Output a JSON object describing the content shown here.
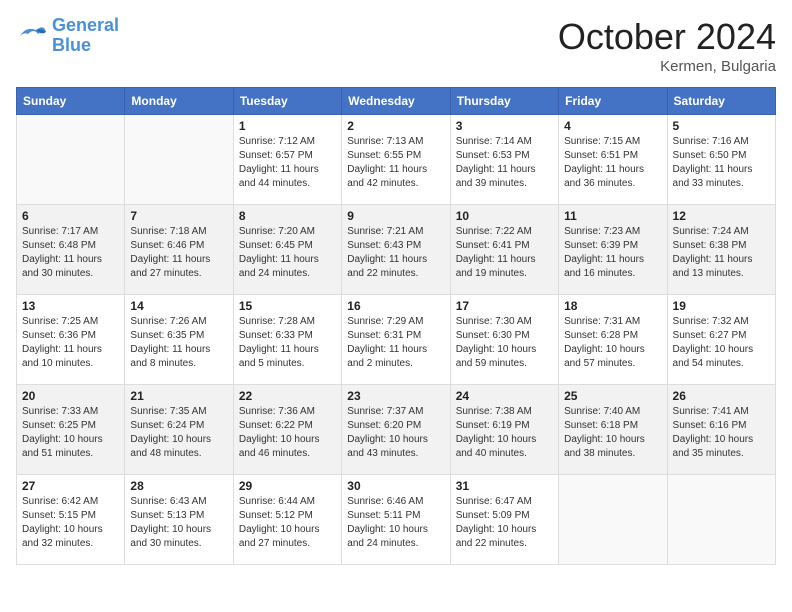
{
  "logo": {
    "line1": "General",
    "line2": "Blue"
  },
  "title": "October 2024",
  "location": "Kermen, Bulgaria",
  "days_of_week": [
    "Sunday",
    "Monday",
    "Tuesday",
    "Wednesday",
    "Thursday",
    "Friday",
    "Saturday"
  ],
  "weeks": [
    [
      {
        "day": "",
        "info": ""
      },
      {
        "day": "",
        "info": ""
      },
      {
        "day": "1",
        "sunrise": "Sunrise: 7:12 AM",
        "sunset": "Sunset: 6:57 PM",
        "daylight": "Daylight: 11 hours and 44 minutes."
      },
      {
        "day": "2",
        "sunrise": "Sunrise: 7:13 AM",
        "sunset": "Sunset: 6:55 PM",
        "daylight": "Daylight: 11 hours and 42 minutes."
      },
      {
        "day": "3",
        "sunrise": "Sunrise: 7:14 AM",
        "sunset": "Sunset: 6:53 PM",
        "daylight": "Daylight: 11 hours and 39 minutes."
      },
      {
        "day": "4",
        "sunrise": "Sunrise: 7:15 AM",
        "sunset": "Sunset: 6:51 PM",
        "daylight": "Daylight: 11 hours and 36 minutes."
      },
      {
        "day": "5",
        "sunrise": "Sunrise: 7:16 AM",
        "sunset": "Sunset: 6:50 PM",
        "daylight": "Daylight: 11 hours and 33 minutes."
      }
    ],
    [
      {
        "day": "6",
        "sunrise": "Sunrise: 7:17 AM",
        "sunset": "Sunset: 6:48 PM",
        "daylight": "Daylight: 11 hours and 30 minutes."
      },
      {
        "day": "7",
        "sunrise": "Sunrise: 7:18 AM",
        "sunset": "Sunset: 6:46 PM",
        "daylight": "Daylight: 11 hours and 27 minutes."
      },
      {
        "day": "8",
        "sunrise": "Sunrise: 7:20 AM",
        "sunset": "Sunset: 6:45 PM",
        "daylight": "Daylight: 11 hours and 24 minutes."
      },
      {
        "day": "9",
        "sunrise": "Sunrise: 7:21 AM",
        "sunset": "Sunset: 6:43 PM",
        "daylight": "Daylight: 11 hours and 22 minutes."
      },
      {
        "day": "10",
        "sunrise": "Sunrise: 7:22 AM",
        "sunset": "Sunset: 6:41 PM",
        "daylight": "Daylight: 11 hours and 19 minutes."
      },
      {
        "day": "11",
        "sunrise": "Sunrise: 7:23 AM",
        "sunset": "Sunset: 6:39 PM",
        "daylight": "Daylight: 11 hours and 16 minutes."
      },
      {
        "day": "12",
        "sunrise": "Sunrise: 7:24 AM",
        "sunset": "Sunset: 6:38 PM",
        "daylight": "Daylight: 11 hours and 13 minutes."
      }
    ],
    [
      {
        "day": "13",
        "sunrise": "Sunrise: 7:25 AM",
        "sunset": "Sunset: 6:36 PM",
        "daylight": "Daylight: 11 hours and 10 minutes."
      },
      {
        "day": "14",
        "sunrise": "Sunrise: 7:26 AM",
        "sunset": "Sunset: 6:35 PM",
        "daylight": "Daylight: 11 hours and 8 minutes."
      },
      {
        "day": "15",
        "sunrise": "Sunrise: 7:28 AM",
        "sunset": "Sunset: 6:33 PM",
        "daylight": "Daylight: 11 hours and 5 minutes."
      },
      {
        "day": "16",
        "sunrise": "Sunrise: 7:29 AM",
        "sunset": "Sunset: 6:31 PM",
        "daylight": "Daylight: 11 hours and 2 minutes."
      },
      {
        "day": "17",
        "sunrise": "Sunrise: 7:30 AM",
        "sunset": "Sunset: 6:30 PM",
        "daylight": "Daylight: 10 hours and 59 minutes."
      },
      {
        "day": "18",
        "sunrise": "Sunrise: 7:31 AM",
        "sunset": "Sunset: 6:28 PM",
        "daylight": "Daylight: 10 hours and 57 minutes."
      },
      {
        "day": "19",
        "sunrise": "Sunrise: 7:32 AM",
        "sunset": "Sunset: 6:27 PM",
        "daylight": "Daylight: 10 hours and 54 minutes."
      }
    ],
    [
      {
        "day": "20",
        "sunrise": "Sunrise: 7:33 AM",
        "sunset": "Sunset: 6:25 PM",
        "daylight": "Daylight: 10 hours and 51 minutes."
      },
      {
        "day": "21",
        "sunrise": "Sunrise: 7:35 AM",
        "sunset": "Sunset: 6:24 PM",
        "daylight": "Daylight: 10 hours and 48 minutes."
      },
      {
        "day": "22",
        "sunrise": "Sunrise: 7:36 AM",
        "sunset": "Sunset: 6:22 PM",
        "daylight": "Daylight: 10 hours and 46 minutes."
      },
      {
        "day": "23",
        "sunrise": "Sunrise: 7:37 AM",
        "sunset": "Sunset: 6:20 PM",
        "daylight": "Daylight: 10 hours and 43 minutes."
      },
      {
        "day": "24",
        "sunrise": "Sunrise: 7:38 AM",
        "sunset": "Sunset: 6:19 PM",
        "daylight": "Daylight: 10 hours and 40 minutes."
      },
      {
        "day": "25",
        "sunrise": "Sunrise: 7:40 AM",
        "sunset": "Sunset: 6:18 PM",
        "daylight": "Daylight: 10 hours and 38 minutes."
      },
      {
        "day": "26",
        "sunrise": "Sunrise: 7:41 AM",
        "sunset": "Sunset: 6:16 PM",
        "daylight": "Daylight: 10 hours and 35 minutes."
      }
    ],
    [
      {
        "day": "27",
        "sunrise": "Sunrise: 6:42 AM",
        "sunset": "Sunset: 5:15 PM",
        "daylight": "Daylight: 10 hours and 32 minutes."
      },
      {
        "day": "28",
        "sunrise": "Sunrise: 6:43 AM",
        "sunset": "Sunset: 5:13 PM",
        "daylight": "Daylight: 10 hours and 30 minutes."
      },
      {
        "day": "29",
        "sunrise": "Sunrise: 6:44 AM",
        "sunset": "Sunset: 5:12 PM",
        "daylight": "Daylight: 10 hours and 27 minutes."
      },
      {
        "day": "30",
        "sunrise": "Sunrise: 6:46 AM",
        "sunset": "Sunset: 5:11 PM",
        "daylight": "Daylight: 10 hours and 24 minutes."
      },
      {
        "day": "31",
        "sunrise": "Sunrise: 6:47 AM",
        "sunset": "Sunset: 5:09 PM",
        "daylight": "Daylight: 10 hours and 22 minutes."
      },
      {
        "day": "",
        "info": ""
      },
      {
        "day": "",
        "info": ""
      }
    ]
  ]
}
